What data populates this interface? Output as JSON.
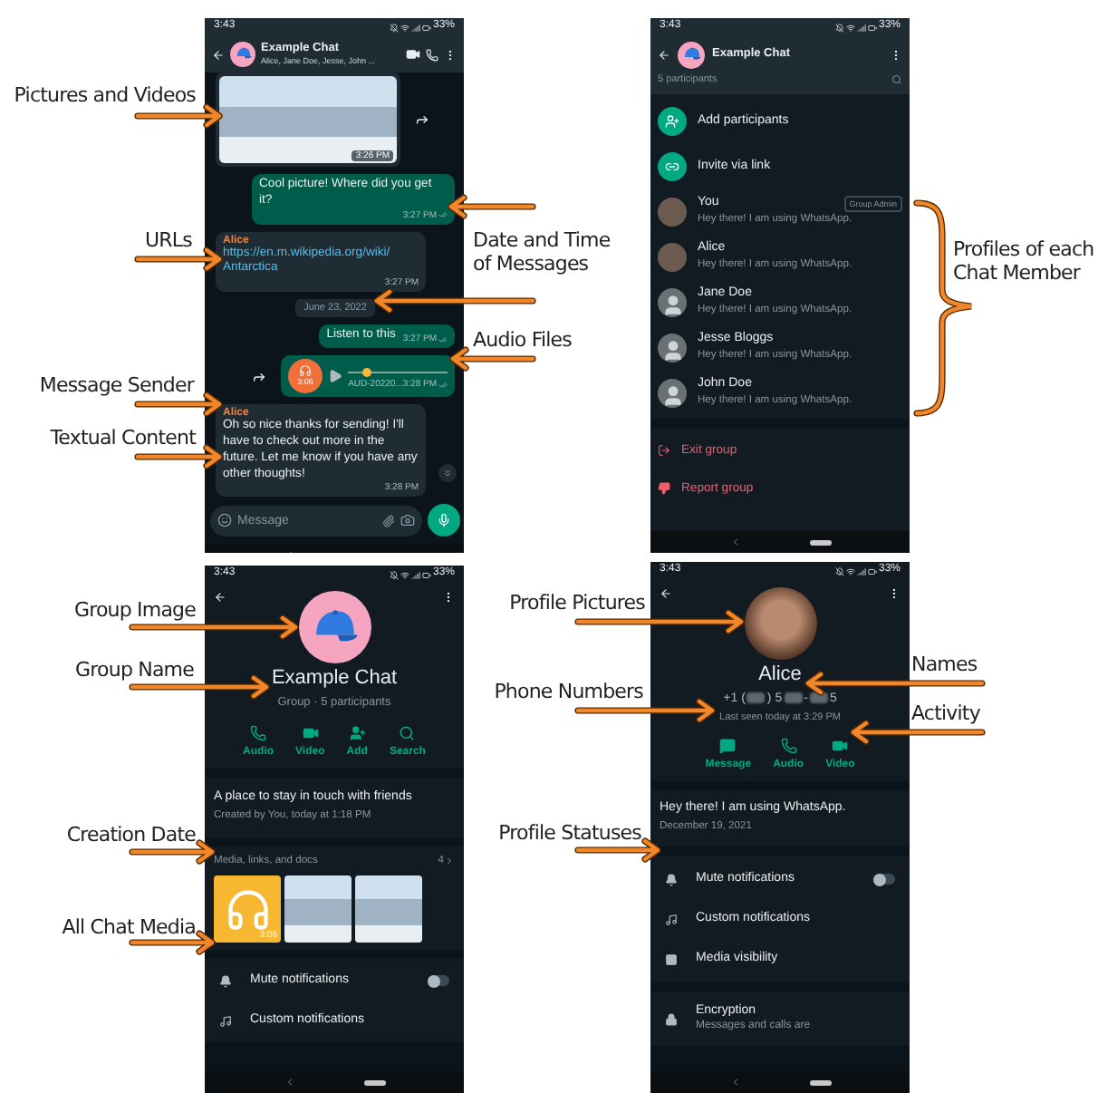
{
  "annotations": [
    {
      "kind": "arrow",
      "text": "Pictures and Videos"
    },
    {
      "kind": "arrow",
      "text": "URLs"
    },
    {
      "kind": "arrow",
      "text": "Message Sender"
    },
    {
      "kind": "arrow",
      "text": "Textual Content"
    },
    {
      "kind": "arrow",
      "text": "Date and Time of Messages"
    },
    {
      "kind": "arrow",
      "text": "Audio Files"
    },
    {
      "kind": "brace",
      "text": "Profiles of each Chat Member"
    },
    {
      "kind": "arrow",
      "text": "Group Image"
    },
    {
      "kind": "arrow",
      "text": "Group Name"
    },
    {
      "kind": "arrow",
      "text": "Creation Date"
    },
    {
      "kind": "arrow",
      "text": "All Chat Media"
    },
    {
      "kind": "arrow",
      "text": "Profile Pictures"
    },
    {
      "kind": "arrow",
      "text": "Phone Numbers"
    },
    {
      "kind": "arrow",
      "text": "Profile Statuses"
    },
    {
      "kind": "arrow",
      "text": "Names"
    },
    {
      "kind": "arrow",
      "text": "Activity"
    }
  ],
  "chat_screen": {
    "status_bar": {
      "time": "3:43",
      "battery": "33%"
    },
    "header": {
      "title": "Example Chat",
      "subtitle": "Alice, Jane Doe, Jesse, John ..."
    },
    "messages": [
      {
        "kind": "image",
        "time": "3:26 PM"
      },
      {
        "kind": "text",
        "outgoing": true,
        "text": "Cool picture! Where did you get it?",
        "time": "3:27 PM"
      },
      {
        "kind": "link",
        "outgoing": false,
        "sender": "Alice",
        "text": "https://en.m.wikipedia.org/wiki/Antarctica",
        "time": "3:27 PM"
      },
      {
        "kind": "date",
        "text": "June 23, 2022"
      },
      {
        "kind": "text",
        "outgoing": true,
        "text": "Listen to this",
        "time": "3:27 PM"
      },
      {
        "kind": "audio",
        "outgoing": true,
        "duration": "3:06",
        "filename": "AUD-20220...",
        "time": "3:28 PM",
        "level": 0.15
      },
      {
        "kind": "text",
        "outgoing": false,
        "sender": "Alice",
        "text": "Oh so nice thanks for sending! I'll have to check out more in the future. Let me know if you have any other thoughts!",
        "time": "3:28 PM"
      }
    ],
    "composer": {
      "placeholder": "Message"
    }
  },
  "participants_screen": {
    "status_bar": {
      "time": "3:43",
      "battery": "33%"
    },
    "header": {
      "title": "Example Chat"
    },
    "count": "5 participants",
    "actions": [
      {
        "label": "Add participants"
      },
      {
        "label": "Invite via link"
      }
    ],
    "members": [
      {
        "name": "You",
        "status": "Hey there! I am using WhatsApp.",
        "badge": "Group Admin"
      },
      {
        "name": "Alice",
        "status": "Hey there! I am using WhatsApp."
      },
      {
        "name": "Jane Doe",
        "status": "Hey there! I am using WhatsApp."
      },
      {
        "name": "Jesse Bloggs",
        "status": "Hey there! I am using WhatsApp."
      },
      {
        "name": "John Doe",
        "status": "Hey there! I am using WhatsApp."
      }
    ],
    "group_actions": [
      {
        "label": "Exit group"
      },
      {
        "label": "Report group"
      }
    ]
  },
  "group_info_screen": {
    "status_bar": {
      "time": "3:43",
      "battery": "33%"
    },
    "name": "Example Chat",
    "subtitle": "Group · 5 participants",
    "actions": [
      {
        "label": "Audio"
      },
      {
        "label": "Video"
      },
      {
        "label": "Add"
      },
      {
        "label": "Search"
      }
    ],
    "description": "A place to stay in touch with friends",
    "created": "Created by You, today at 1:18 PM",
    "media": {
      "title": "Media, links, and docs",
      "count": "4",
      "items": [
        {
          "kind": "audio",
          "duration": "3:06"
        },
        {
          "kind": "image"
        },
        {
          "kind": "image"
        }
      ]
    },
    "settings": [
      {
        "kind": "toggle",
        "label": "Mute notifications",
        "on": false
      },
      {
        "kind": "plain",
        "label": "Custom notifications"
      }
    ]
  },
  "contact_screen": {
    "status_bar": {
      "time": "3:43",
      "battery": "33%"
    },
    "name": "Alice",
    "phone": [
      "+1 (",
      ") 5",
      "-",
      "5"
    ],
    "last_seen": "Last seen today at 3:29 PM",
    "actions": [
      {
        "label": "Message"
      },
      {
        "label": "Audio"
      },
      {
        "label": "Video"
      }
    ],
    "about": "Hey there! I am using WhatsApp.",
    "about_date": "December 19, 2021",
    "settings": [
      {
        "kind": "toggle",
        "label": "Mute notifications",
        "on": false
      },
      {
        "kind": "plain",
        "label": "Custom notifications"
      },
      {
        "kind": "plain",
        "label": "Media visibility"
      },
      {
        "kind": "detail",
        "label": "Encryption",
        "detail": "Messages and calls are"
      }
    ]
  }
}
